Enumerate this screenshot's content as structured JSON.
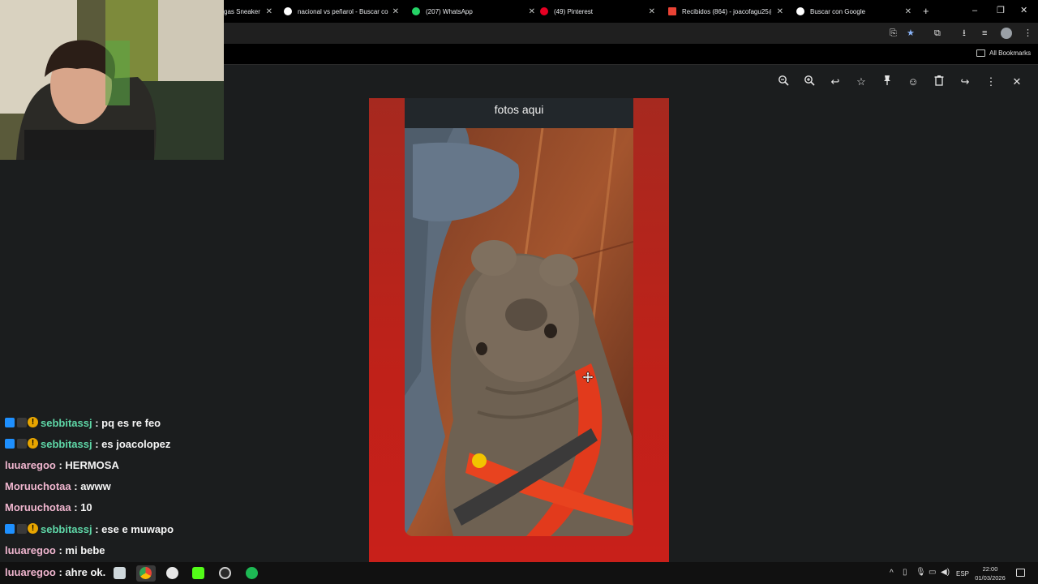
{
  "browser": {
    "tabs": [
      {
        "title": "gas Sneaker",
        "favicon_color": "#4285f4"
      },
      {
        "title": "nacional vs peñarol - Buscar co",
        "favicon_color": "#ffffff"
      },
      {
        "title": "(207) WhatsApp",
        "favicon_color": "#25d366"
      },
      {
        "title": "(49) Pinterest",
        "favicon_color": "#e60023"
      },
      {
        "title": "Recibidos (864) - joacofagu25@",
        "favicon_color": "#ea4335"
      },
      {
        "title": "Buscar con Google",
        "favicon_color": "#ffffff"
      }
    ],
    "bookmarks_label": "All Bookmarks"
  },
  "viewer": {
    "card_title": "fotos aqui",
    "toolbar_icons": [
      "zoom-out-icon",
      "zoom-in-icon",
      "reply-icon",
      "star-icon",
      "pin-icon",
      "emoji-icon",
      "delete-icon",
      "forward-icon",
      "more-icon",
      "close-icon"
    ]
  },
  "chat": [
    {
      "user": "sebbitassj",
      "message": ": pq es re feo",
      "color": "#5fd8a8",
      "badges": true
    },
    {
      "user": "sebbitassj",
      "message": ": es joacolopez",
      "color": "#5fd8a8",
      "badges": true
    },
    {
      "user": "luuaregoo",
      "message": ": HERMOSA",
      "color": "#f0b6cf",
      "badges": false
    },
    {
      "user": "Moruuchotaa",
      "message": ": awww",
      "color": "#f0b6cf",
      "badges": false
    },
    {
      "user": "Moruuchotaa",
      "message": ": 10",
      "color": "#f0b6cf",
      "badges": false
    },
    {
      "user": "sebbitassj",
      "message": ": ese e muwapo",
      "color": "#5fd8a8",
      "badges": true
    },
    {
      "user": "luuaregoo",
      "message": ": mi bebe",
      "color": "#f0b6cf",
      "badges": false
    },
    {
      "user": "luuaregoo",
      "message": ": ahre ok.",
      "color": "#f0b6cf",
      "badges": false
    }
  ],
  "taskbar": {
    "language": "ESP",
    "time": "22:00",
    "date": "01/03/2026"
  }
}
